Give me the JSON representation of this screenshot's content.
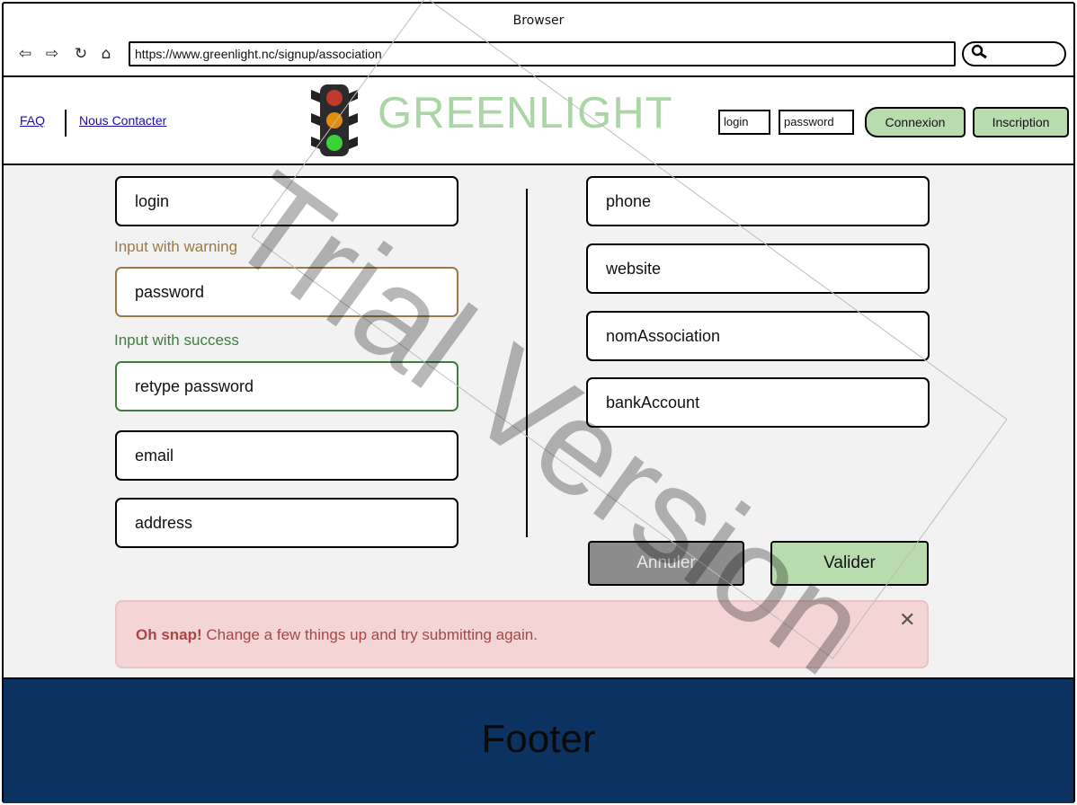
{
  "browser": {
    "title": "Browser",
    "url": "https://www.greenlight.nc/signup/association"
  },
  "header": {
    "links": {
      "faq": "FAQ",
      "contact": "Nous Contacter"
    },
    "brand": "GREENLIGHT",
    "login_placeholder": "login",
    "password_placeholder": "password",
    "connexion_label": "Connexion",
    "inscription_label": "Inscription"
  },
  "form": {
    "left_fields": {
      "login": "login",
      "password": "password",
      "retype_password": "retype password",
      "email": "email",
      "address": "address"
    },
    "warning_label": "Input with warning",
    "success_label": "Input with success",
    "right_fields": {
      "phone": "phone",
      "website": "website",
      "nom_association": "nomAssociation",
      "bank_account": "bankAccount"
    },
    "buttons": {
      "cancel": "Annuler",
      "submit": "Valider"
    }
  },
  "alert": {
    "strong": "Oh snap!",
    "message": " Change a few things up and try submitting again."
  },
  "footer": {
    "text": "Footer"
  },
  "watermark": "Trial Version",
  "colors": {
    "brand_green": "#a9d6a4",
    "button_green": "#b8dcad",
    "warning": "#9b7a45",
    "success": "#3f7d3f",
    "alert_bg": "#f4d5d6",
    "alert_text": "#a84646",
    "footer_bg": "#0b3260"
  }
}
